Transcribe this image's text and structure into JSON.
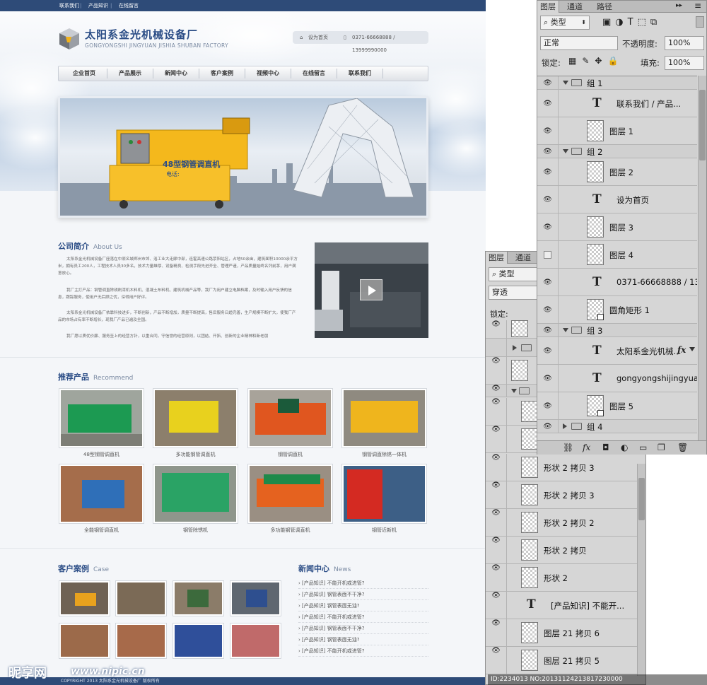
{
  "topbar": {
    "links": [
      "联系我们",
      "产品知识",
      "在线留言"
    ]
  },
  "logo": {
    "title": "太阳系金光机械设备厂",
    "subtitle": "GONGYONGSHI JINGYUAN JISHIA SHUBAN FACTORY"
  },
  "contact": {
    "homepage": "设为首页",
    "phone": "0371-66668888 / 13999990000"
  },
  "nav": [
    "企业首页",
    "产品展示",
    "新闻中心",
    "客户案例",
    "视频中心",
    "在线留言",
    "联系我们"
  ],
  "banner": {
    "machine_label": "48型钢管调直机",
    "machine_sub": "电话:"
  },
  "about": {
    "title": "公司简介",
    "title_en": "About Us",
    "paragraphs": [
      "太阳系金光机械设备厂座落在中原名城郑州市郊、洛工业大走廊中部，连霍高速公路荥阳站区，占地50余亩，建筑面积10000余平方米，拥有员工200人，工程技术人员30多名，技术力量雄厚、设备精良、检测手段先进齐全、管理严谨，产品质量始终名列前茅，用户满意放心。",
      "我厂主打产品：钢管调直除锈刷漆机木料机、混凝土布料机、建筑机械产品等，我厂为用户建立电脑档案，及时输入用户反馈的信息，跟踪服务，使用户无后顾之忧，深得用户好评。",
      "太阳系金光机械设备厂依靠科技进步，不断创新，产品不断增加，质量不断提高，售后服务日趋完善，生产规模不断扩大，使我厂产品的市场占有率不断增长，现我厂产品已遍及全国。",
      "我厂愿以质优价廉、服务至上的经营方针，以重合同，守信誉的经营原则，以团结、开拓、创新的企业精神和新老朋"
    ]
  },
  "products": {
    "title": "推荐产品",
    "title_en": "Recommend",
    "items": [
      "48型钢管调直机",
      "多功能钢管调直机",
      "钢管调直机",
      "钢管调直除锈一体机",
      "全能钢管调直机",
      "钢管除锈机",
      "多功能钢管调直机",
      "钢管近新机"
    ]
  },
  "cases": {
    "title": "客户案例",
    "title_en": "Case"
  },
  "news": {
    "title": "新闻中心",
    "title_en": "News",
    "items": [
      "[产品知识] 不能开机或进管?",
      "[产品知识] 钢管表面不干净?",
      "[产品知识] 钢管表面无油?",
      "[产品知识] 不能开机或进管?",
      "[产品知识] 钢管表面不干净?",
      "[产品知识] 钢管表面无油?",
      "[产品知识] 不能开机或进管?"
    ]
  },
  "footer": {
    "copyright": "COPYRIGHT 2013 太阳系金光机械设备厂  版权所有"
  },
  "panel_main": {
    "tabs": [
      "图层",
      "通道",
      "路径"
    ],
    "filter_kind": "类型",
    "blend_mode": "正常",
    "opacity_label": "不透明度:",
    "opacity_value": "100%",
    "lock_label": "锁定:",
    "fill_label": "填充:",
    "fill_value": "100%",
    "layers": [
      {
        "type": "group",
        "name": "组 1",
        "depth": 0,
        "open": true
      },
      {
        "type": "text",
        "name": "联系我们   /   产品...",
        "depth": 1
      },
      {
        "type": "raster",
        "name": "图层 1",
        "depth": 1
      },
      {
        "type": "group",
        "name": "组 2",
        "depth": 0,
        "open": true
      },
      {
        "type": "raster",
        "name": "图层 2",
        "depth": 1
      },
      {
        "type": "text",
        "name": "设为首页",
        "depth": 1
      },
      {
        "type": "raster",
        "name": "图层 3",
        "depth": 1
      },
      {
        "type": "raster",
        "name": "图层 4",
        "depth": 1,
        "hidden": true
      },
      {
        "type": "text",
        "name": "0371-66668888  / 13...",
        "depth": 1
      },
      {
        "type": "shape",
        "name": "圆角矩形 1",
        "depth": 1
      },
      {
        "type": "group",
        "name": "组 3",
        "depth": 0,
        "open": true
      },
      {
        "type": "text",
        "name": "太阳系金光机械...",
        "depth": 1,
        "fx": "fx"
      },
      {
        "type": "text",
        "name": "gongyongshijingyuan...",
        "depth": 1
      },
      {
        "type": "shape",
        "name": "图层 5",
        "depth": 1
      },
      {
        "type": "group",
        "name": "组 4",
        "depth": 0,
        "open": false
      }
    ]
  },
  "panel_back": {
    "tabs": [
      "图层",
      "通道"
    ],
    "filter_kind": "类型",
    "blend_mode": "穿透",
    "lock_label": "锁定:",
    "layers": [
      "形状 2 拷贝 3",
      "形状 2 拷贝 3",
      "形状 2 拷贝 2",
      "形状 2 拷贝",
      "形状 2",
      "[产品知识] 不能开...",
      "图层 21 拷贝 6",
      "图层 21 拷贝 5"
    ]
  },
  "watermark": {
    "brand": "昵享网",
    "url": "www.nipic.cn",
    "id": "ID:2234013 NO:20131124213817230000"
  }
}
